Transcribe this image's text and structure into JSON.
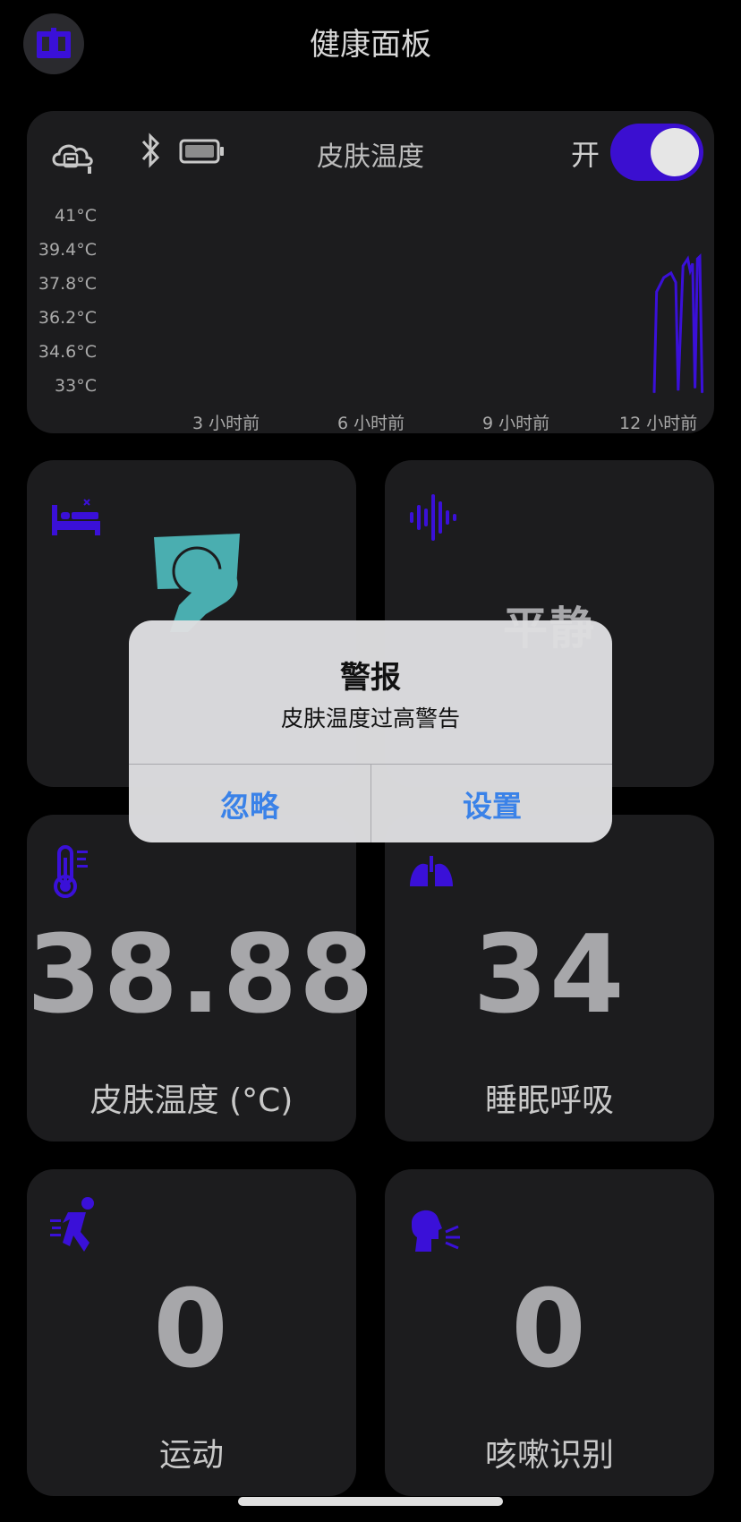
{
  "header": {
    "title": "健康面板"
  },
  "skin_temp_card": {
    "title": "皮肤温度",
    "toggle_label": "开",
    "toggle_on": true
  },
  "chart_data": {
    "type": "line",
    "title": "皮肤温度",
    "y_ticks": [
      "41°C",
      "39.4°C",
      "37.8°C",
      "36.2°C",
      "34.6°C",
      "33°C"
    ],
    "x_ticks": [
      "3 小时前",
      "6 小时前",
      "9 小时前",
      "12 小时前"
    ],
    "ylim": [
      33,
      41
    ],
    "series_color": "#3a10d8",
    "x": [
      11.2,
      11.25,
      11.4,
      11.55,
      11.65,
      11.7,
      11.8,
      11.9,
      11.95,
      12.0,
      12.05,
      12.1,
      12.15,
      12.2
    ],
    "values": [
      33.2,
      37.5,
      38.1,
      38.3,
      37.9,
      33.3,
      38.6,
      38.9,
      38.4,
      38.7,
      33.4,
      38.9,
      39.0,
      33.2
    ]
  },
  "tiles": {
    "sleep": {
      "icon": "bed-icon"
    },
    "sound": {
      "icon": "sound-wave-icon",
      "value": "平静"
    },
    "temperature": {
      "icon": "thermometer-icon",
      "value": "38.88",
      "label": "皮肤温度 (°C)"
    },
    "breathing": {
      "icon": "lungs-icon",
      "value": "34",
      "label": "睡眠呼吸"
    },
    "activity": {
      "icon": "running-icon",
      "value": "0",
      "label": "运动"
    },
    "cough": {
      "icon": "cough-icon",
      "value": "0",
      "label": "咳嗽识别"
    }
  },
  "alert": {
    "title": "警报",
    "message": "皮肤温度过高警告",
    "ignore_label": "忽略",
    "settings_label": "设置"
  },
  "colors": {
    "accent": "#3a10d8",
    "alert_button": "#3a82e8",
    "sleep_pose": "#4aaeb0"
  }
}
